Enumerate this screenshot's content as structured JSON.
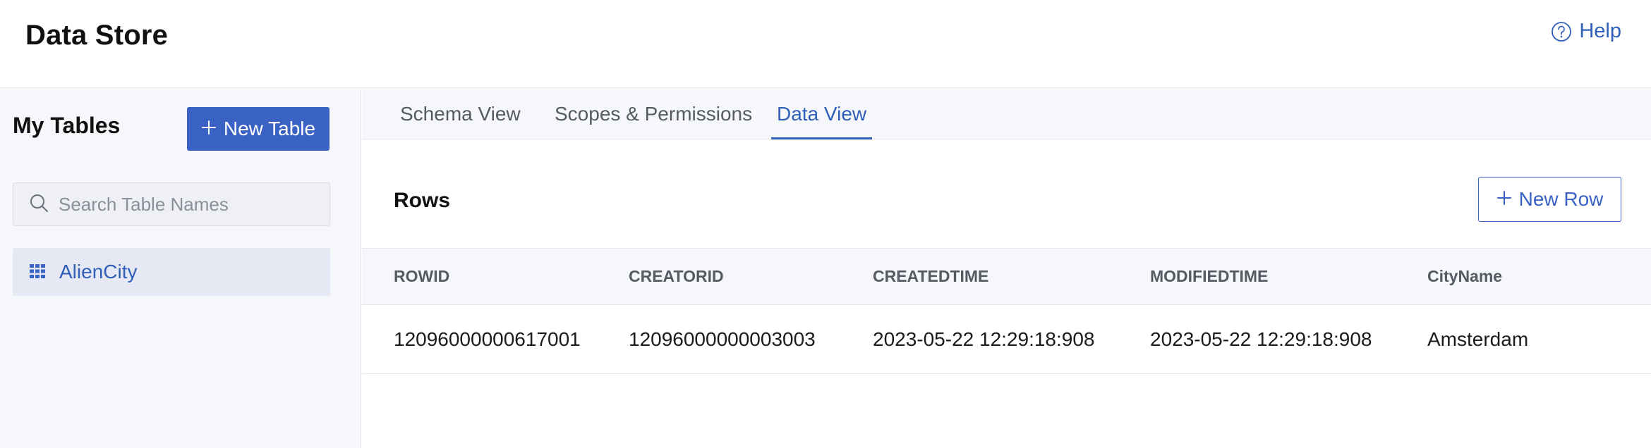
{
  "header": {
    "title": "Data Store",
    "help_label": "Help",
    "help_icon": "question-circle-icon"
  },
  "sidebar": {
    "title": "My Tables",
    "new_table_label": "New Table",
    "search_placeholder": "Search Table Names",
    "tables": [
      {
        "label": "AlienCity",
        "icon": "grid-table-icon",
        "selected": true
      }
    ]
  },
  "tabs": [
    {
      "label": "Schema View",
      "active": false
    },
    {
      "label": "Scopes & Permissions",
      "active": false
    },
    {
      "label": "Data View",
      "active": true
    }
  ],
  "main": {
    "section_title": "Rows",
    "new_row_label": "New Row",
    "table": {
      "columns": [
        "ROWID",
        "CREATORID",
        "CREATEDTIME",
        "MODIFIEDTIME",
        "CityName"
      ],
      "rows": [
        [
          "12096000000617001",
          "12096000000003003",
          "2023-05-22 12:29:18:908",
          "2023-05-22 12:29:18:908",
          "Amsterdam"
        ]
      ]
    }
  },
  "colors": {
    "accent": "#3a61c4",
    "link": "#2f5fb8",
    "sidebar_bg": "#f6f7fa",
    "selected_item_bg": "#e6e9f3"
  }
}
